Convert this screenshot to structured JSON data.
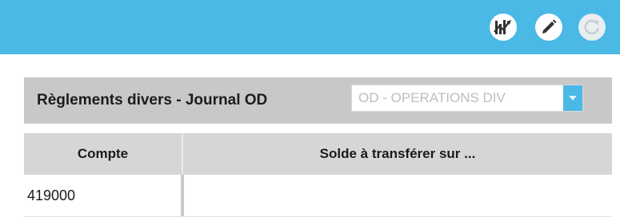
{
  "toolbar": {
    "buttons": [
      {
        "icon": "chart-icon",
        "disabled": false
      },
      {
        "icon": "pencil-icon",
        "disabled": false
      },
      {
        "icon": "refresh-icon",
        "disabled": true
      }
    ],
    "accent_color": "#4ab9e6"
  },
  "panel": {
    "title": "Règlements divers - Journal OD",
    "journal_select": {
      "value": "OD - OPERATIONS DIV",
      "icon": "caret-down-icon"
    }
  },
  "table": {
    "columns": [
      "Compte",
      "Solde à transférer sur ..."
    ],
    "rows": [
      {
        "compte": "419000",
        "solde": ""
      }
    ]
  }
}
